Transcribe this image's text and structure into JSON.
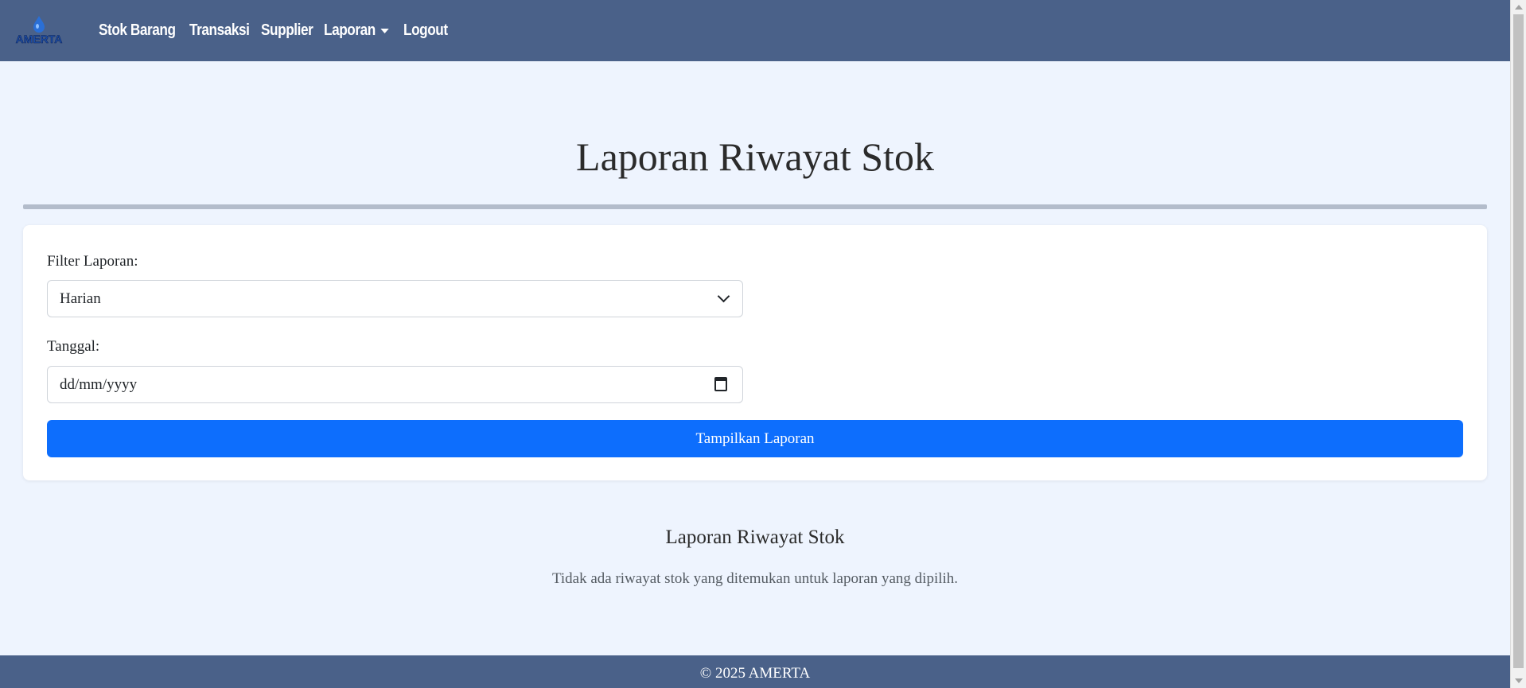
{
  "brand": {
    "logo_text": "AMERTA"
  },
  "nav": {
    "items": [
      {
        "label": "Stok Barang"
      },
      {
        "label": "Transaksi"
      },
      {
        "label": "Supplier"
      },
      {
        "label": "Laporan"
      },
      {
        "label": "Logout"
      }
    ]
  },
  "page": {
    "title": "Laporan Riwayat Stok"
  },
  "form": {
    "filter_label": "Filter Laporan:",
    "filter_value": "Harian",
    "date_label": "Tanggal:",
    "date_placeholder": "dd/mm/yyyy",
    "submit_label": "Tampilkan Laporan"
  },
  "result": {
    "title": "Laporan Riwayat Stok",
    "empty_message": "Tidak ada riwayat stok yang ditemukan untuk laporan yang dipilih."
  },
  "footer": {
    "text": "© 2025 AMERTA"
  },
  "colors": {
    "navbar": "#4a6189",
    "background": "#eef4fe",
    "primary_button": "#0d6efd"
  }
}
